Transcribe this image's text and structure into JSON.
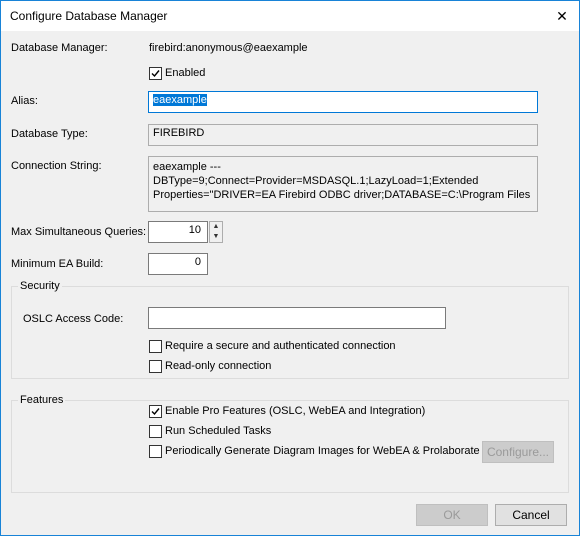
{
  "window": {
    "title": "Configure Database Manager",
    "close_glyph": "✕"
  },
  "form": {
    "db_manager_label": "Database Manager:",
    "db_manager_value": "firebird:anonymous@eaexample",
    "enabled_label": "Enabled",
    "enabled_checked": true,
    "alias_label": "Alias:",
    "alias_value": "eaexample",
    "db_type_label": "Database Type:",
    "db_type_value": "FIREBIRD",
    "conn_string_label": "Connection String:",
    "conn_string_value": "eaexample --- DBType=9;Connect=Provider=MSDASQL.1;LazyLoad=1;Extended Properties=\"DRIVER=EA Firebird ODBC driver;DATABASE=C:\\Program Files",
    "max_queries_label": "Max Simultaneous Queries:",
    "max_queries_value": "10",
    "min_build_label": "Minimum EA Build:",
    "min_build_value": "0"
  },
  "security": {
    "title": "Security",
    "oslc_label": "OSLC Access Code:",
    "oslc_value": "",
    "secure_label": "Require a secure and authenticated connection",
    "secure_checked": false,
    "readonly_label": "Read-only connection",
    "readonly_checked": false
  },
  "features": {
    "title": "Features",
    "pro_label": "Enable Pro Features (OSLC, WebEA and Integration)",
    "pro_checked": true,
    "scheduled_label": "Run Scheduled Tasks",
    "scheduled_checked": false,
    "images_label": "Periodically Generate Diagram Images for WebEA & Prolaborate",
    "images_checked": false,
    "configure_label": "Configure..."
  },
  "buttons": {
    "ok_label": "OK",
    "cancel_label": "Cancel"
  },
  "colors": {
    "accent": "#0078d7",
    "window_border": "#1883d7",
    "dialog_bg": "#f0f0f0"
  }
}
